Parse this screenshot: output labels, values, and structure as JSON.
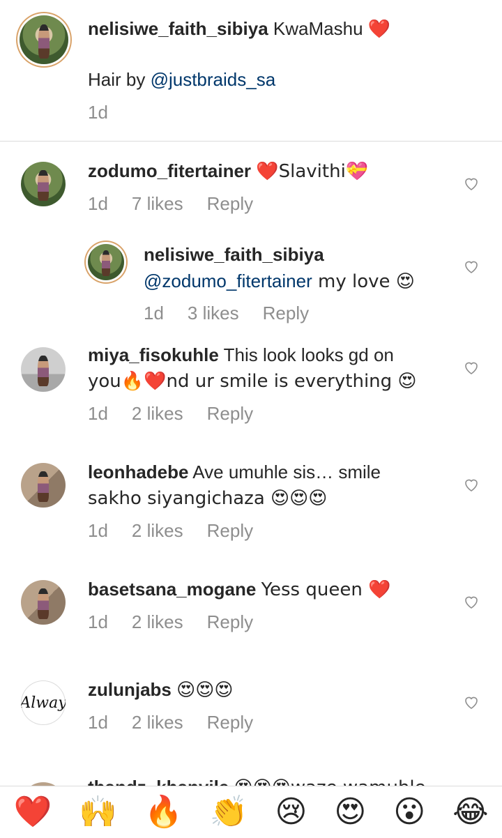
{
  "caption": {
    "username": "nelisiwe_faith_sibiya",
    "text": "KwaMashu",
    "emoji": "❤️",
    "line2_prefix": "Hair by ",
    "line2_mention": "@justbraids_sa",
    "time": "1d"
  },
  "comments": [
    {
      "username": "zodumo_fitertainer",
      "text": "❤️Slavithi💝",
      "time": "1d",
      "likes": "7 likes",
      "reply": "Reply"
    },
    {
      "username": "nelisiwe_faith_sibiya",
      "mention": "@zodumo_fitertainer",
      "text": " my love 😍",
      "time": "1d",
      "likes": "3 likes",
      "reply": "Reply"
    },
    {
      "username": "miya_fisokuhle",
      "text": "This look looks gd on",
      "text2": "you🔥❤️nd ur smile is everything 😍",
      "time": "1d",
      "likes": "2 likes",
      "reply": "Reply"
    },
    {
      "username": "leonhadebe",
      "text": "Ave umuhle sis… smile",
      "text2": "sakho siyangichaza 😍😍😍",
      "time": "1d",
      "likes": "2 likes",
      "reply": "Reply"
    },
    {
      "username": "basetsana_mogane",
      "text": "Yess queen ❤️",
      "time": "1d",
      "likes": "2 likes",
      "reply": "Reply"
    },
    {
      "username": "zulunjabs",
      "text": "😍😍😍",
      "time": "1d",
      "likes": "2 likes",
      "reply": "Reply"
    },
    {
      "username": "thandz_khanyile",
      "text": "😍😍😍waze wamuhle"
    }
  ],
  "avatar_logo_text": "Alway",
  "emoji_bar": [
    "❤️",
    "🙌",
    "🔥",
    "👏",
    "😢",
    "😍",
    "😮",
    "😂"
  ]
}
